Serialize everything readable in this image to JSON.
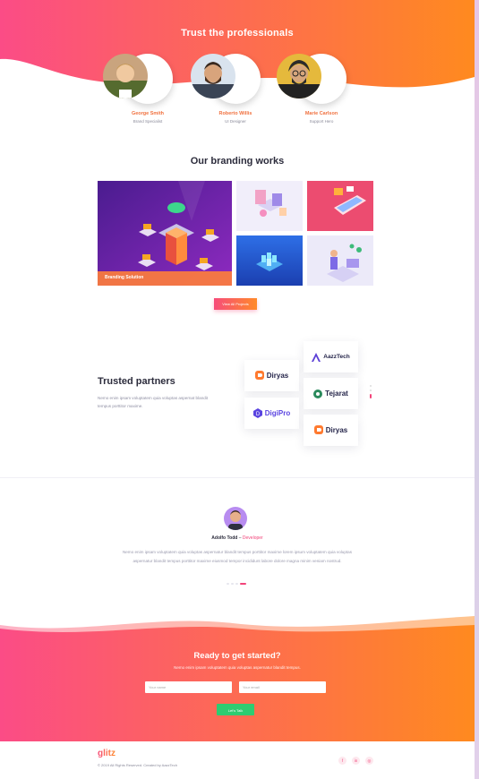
{
  "hero": {
    "title": "Trust the professionals",
    "team": [
      {
        "name": "George Smith",
        "role": "Brand Specialist"
      },
      {
        "name": "Roberto Willis",
        "role": "UI Designer"
      },
      {
        "name": "Marie Carlson",
        "role": "Support Hero"
      }
    ]
  },
  "works": {
    "title": "Our branding works",
    "featured_caption": "Branding Solution",
    "view_all": "View All Projects"
  },
  "partners": {
    "title": "Trusted partners",
    "description": "Nemo enim ipsam voluptatem quia voluptas aspernat blandit tempus porttitor maxime.",
    "logos": [
      "AazzTech",
      "Diryas",
      "Tejarat",
      "DigiPro",
      "Diryas"
    ]
  },
  "testimonial": {
    "name": "Adolfo Todd",
    "separator": "–",
    "role": "Developer",
    "quote": "Nemo enim ipsam voluptatem quia voluptas aspernatur blandit tempus porttitor maxime lorem ipsum voluptatem quia voluptas aspernatur blandit tempus porttitor maxime  eiusmod tempor incididunt labore dolore magna minim veniam nostrud."
  },
  "cta": {
    "title": "Ready to get started?",
    "subtitle": "Nemo enim ipsam voluptatem quia voluptas aspernatur blandit tempus.",
    "name_placeholder": "Your name",
    "email_placeholder": "Your email",
    "button": "Let's Talk"
  },
  "footer": {
    "logo": "glitz",
    "copyright": "© 2019  All Rights Reserved. Created by AazzTech",
    "social": [
      "f",
      "in",
      "◎"
    ]
  },
  "colors": {
    "accent_pink": "#f74c7a",
    "accent_orange": "#ff8a2a",
    "cta_green": "#2ecc71"
  }
}
